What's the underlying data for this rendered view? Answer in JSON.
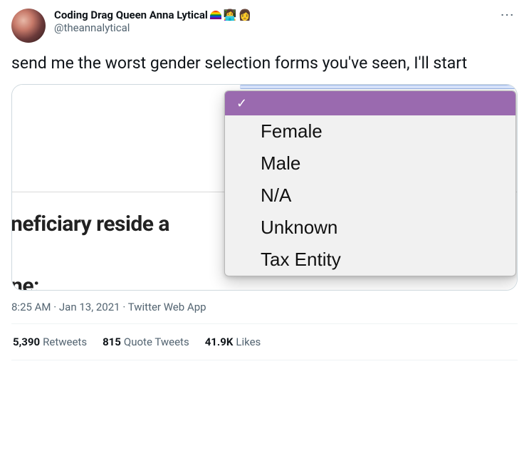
{
  "user": {
    "display_name": "Coding Drag Queen Anna Lytical",
    "handle": "@theannalytical"
  },
  "tweet_text": "send me the worst gender selection forms you've seen, I'll start",
  "embedded_image": {
    "bg_text_1": "neficiary reside a",
    "bg_text_2": "ne:",
    "dropdown_options": [
      "Female",
      "Male",
      "N/A",
      "Unknown",
      "Tax Entity"
    ]
  },
  "meta": {
    "time": "8:25 AM",
    "date": "Jan 13, 2021",
    "source": "Twitter Web App"
  },
  "stats": {
    "retweets_count": "5,390",
    "retweets_label": "Retweets",
    "quotes_count": "815",
    "quotes_label": "Quote Tweets",
    "likes_count": "41.9K",
    "likes_label": "Likes"
  }
}
